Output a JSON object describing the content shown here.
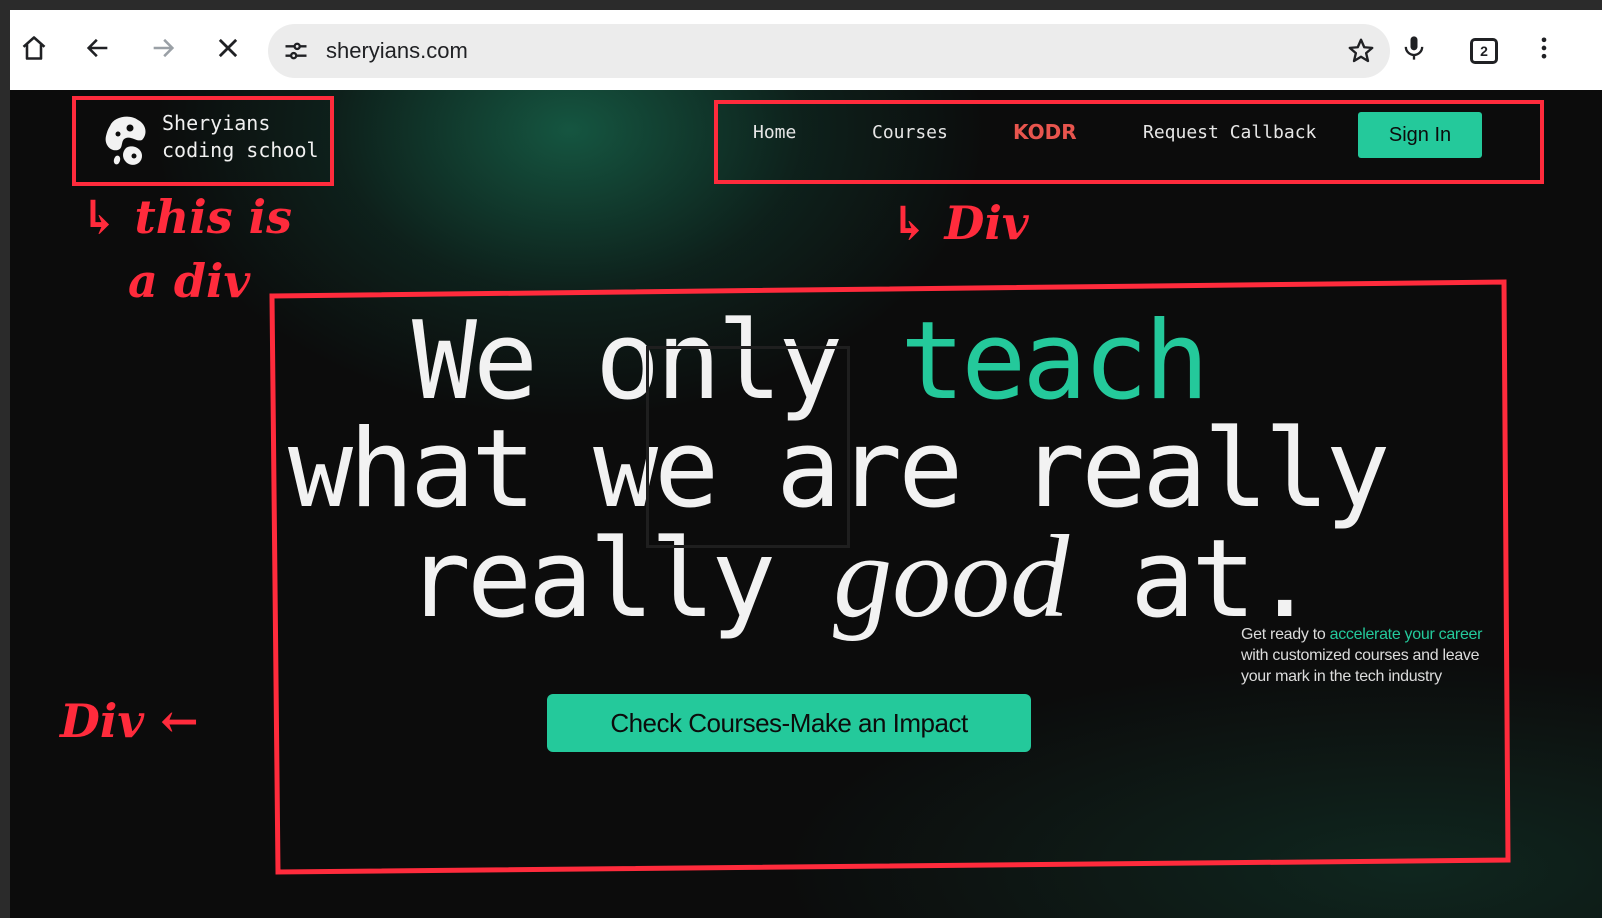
{
  "browser": {
    "url": "sheryians.com",
    "tab_count": "2",
    "icons": [
      "home-icon",
      "back-arrow-icon",
      "forward-arrow-icon",
      "stop-icon",
      "site-settings-icon",
      "bookmark-star-icon",
      "microphone-icon",
      "tab-count-icon",
      "more-menu-icon"
    ]
  },
  "site": {
    "brand_line1": "Sheryians",
    "brand_line2": "coding school",
    "nav": {
      "home": "Home",
      "courses": "Courses",
      "kodr": "KODR",
      "callback": "Request Callback"
    },
    "signin_label": "Sign In",
    "headline": {
      "l1_a": "We only ",
      "l1_b": "teach",
      "l2": "what we are really",
      "l3_a": "really ",
      "l3_b": "good",
      "l3_c": " at."
    },
    "blurb": {
      "a": "Get ready to ",
      "b": "accelerate your career",
      "c": " with customized courses and leave your mark in the tech industry"
    },
    "cta_label": "Check Courses-Make an Impact",
    "colors": {
      "accent": "#24c99b",
      "kodr": "#e8554e",
      "annotation": "#ff2b3c"
    }
  },
  "annotations": {
    "logo_note_1": "↳ this is",
    "logo_note_2": "a div",
    "nav_note": "↳ Div",
    "hero_note": "Div ←"
  }
}
